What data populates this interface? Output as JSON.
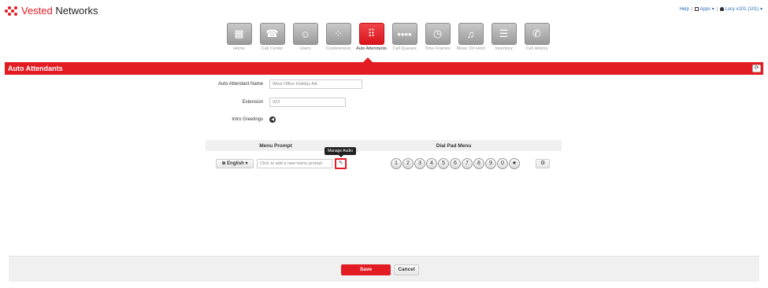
{
  "app": {
    "logo_prefix": "Vested",
    "logo_suffix": " Networks"
  },
  "topbar": {
    "help": "Help",
    "apps": "Apps",
    "user": "Lucy x101 (101)"
  },
  "nav": [
    {
      "label": "Home",
      "icon": "home-grid-icon",
      "glyph": "▦",
      "active": false
    },
    {
      "label": "Call Center",
      "icon": "headset-icon",
      "glyph": "☎",
      "active": false
    },
    {
      "label": "Users",
      "icon": "users-icon",
      "glyph": "☺",
      "active": false
    },
    {
      "label": "Conferences",
      "icon": "conference-icon",
      "glyph": "⁘",
      "active": false
    },
    {
      "label": "Auto Attendants",
      "icon": "keypad-icon",
      "glyph": "⠿",
      "active": true
    },
    {
      "label": "Call Queues",
      "icon": "queue-dots-icon",
      "glyph": "••••",
      "active": false
    },
    {
      "label": "Time Frames",
      "icon": "clock-icon",
      "glyph": "◷",
      "active": false
    },
    {
      "label": "Music On Hold",
      "icon": "music-icon",
      "glyph": "♫",
      "active": false
    },
    {
      "label": "Inventory",
      "icon": "list-icon",
      "glyph": "☰",
      "active": false
    },
    {
      "label": "Call History",
      "icon": "phone-history-icon",
      "glyph": "✆",
      "active": false
    }
  ],
  "page": {
    "title": "Auto Attendants"
  },
  "form": {
    "name_label": "Auto Attendant Name",
    "name_value": "West Office Holiday AA",
    "extension_label": "Extension",
    "extension_value": "923",
    "intro_label": "Intro Greetings"
  },
  "menu": {
    "prompt_header": "Menu Prompt",
    "dialpad_header": "Dial Pad Menu",
    "language": "English",
    "prompt_placeholder": "Click to add a new menu prompt",
    "manage_tooltip": "Manage Audio",
    "keys": [
      "1",
      "2",
      "3",
      "4",
      "5",
      "6",
      "7",
      "8",
      "9",
      "0",
      "★"
    ]
  },
  "footer": {
    "save": "Save",
    "cancel": "Cancel"
  },
  "colors": {
    "accent": "#e31b23",
    "link": "#2a6db5"
  }
}
